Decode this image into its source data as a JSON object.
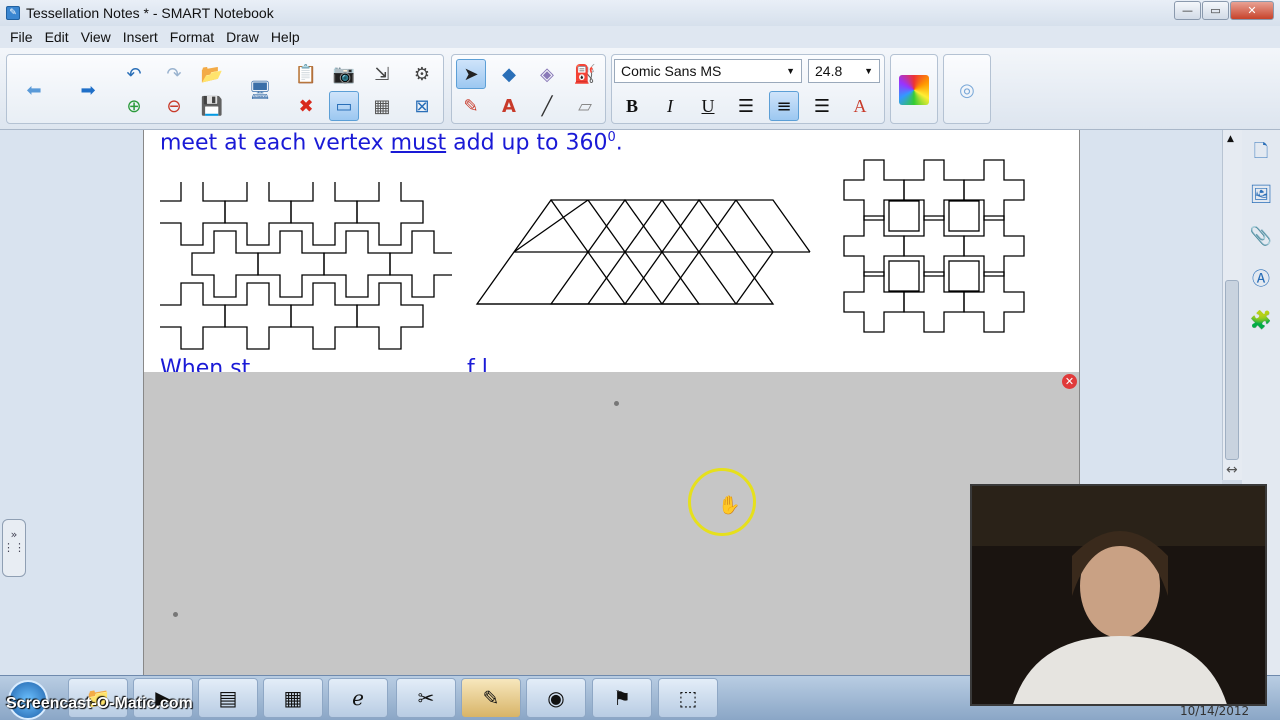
{
  "window": {
    "title": "Tessellation Notes * - SMART Notebook",
    "controls": {
      "minimize": "—",
      "maximize": "▭",
      "close": "✕"
    }
  },
  "menu": [
    "File",
    "Edit",
    "View",
    "Insert",
    "Format",
    "Draw",
    "Help"
  ],
  "toolbar": {
    "font_family": "Comic Sans MS",
    "font_size": "24.8",
    "bold": "B",
    "italic": "I",
    "underline": "U",
    "text_color": "A",
    "icons": {
      "back": "arrow-left-icon",
      "forward": "arrow-right-icon",
      "undo": "undo-icon",
      "redo": "redo-icon",
      "open": "open-folder-icon",
      "add_page": "add-page-icon",
      "delete_page": "delete-page-icon",
      "save": "save-icon",
      "show_screen": "screen-icon",
      "paste": "paste-icon",
      "capture": "camera-icon",
      "full_screen": "full-screen-icon",
      "document_camera": "doc-camera-icon",
      "delete": "delete-icon",
      "screen_shade": "screen-shade-icon",
      "table": "table-icon",
      "dual_view": "dual-view-icon",
      "select": "select-arrow-icon",
      "shapes": "shapes-icon",
      "eraser": "eraser-icon",
      "fill": "fill-icon",
      "pens": "pens-icon",
      "text": "text-icon",
      "line": "line-icon",
      "magic_eraser": "magic-eraser-icon",
      "align_left": "align-left-icon",
      "align_center": "align-center-icon",
      "align_right": "align-right-icon",
      "properties": "properties-icon",
      "color": "color-palette-icon",
      "transparency": "transparency-icon"
    },
    "colors": {
      "selected": "#9cc8f1",
      "accent": "#2b6fb8"
    }
  },
  "page": {
    "text_parts": [
      "meet at each vertex ",
      "must",
      " add up to 360",
      "0",
      "."
    ],
    "text_color": "#1a1ad6",
    "next_line_partial": "When st  ....  ....  ....  ....  ....  ....  f  l",
    "shade_close": "✕"
  },
  "taskbar": {
    "watermark": "Screencast-O-Matic.com",
    "clock_date": "10/14/2012"
  }
}
